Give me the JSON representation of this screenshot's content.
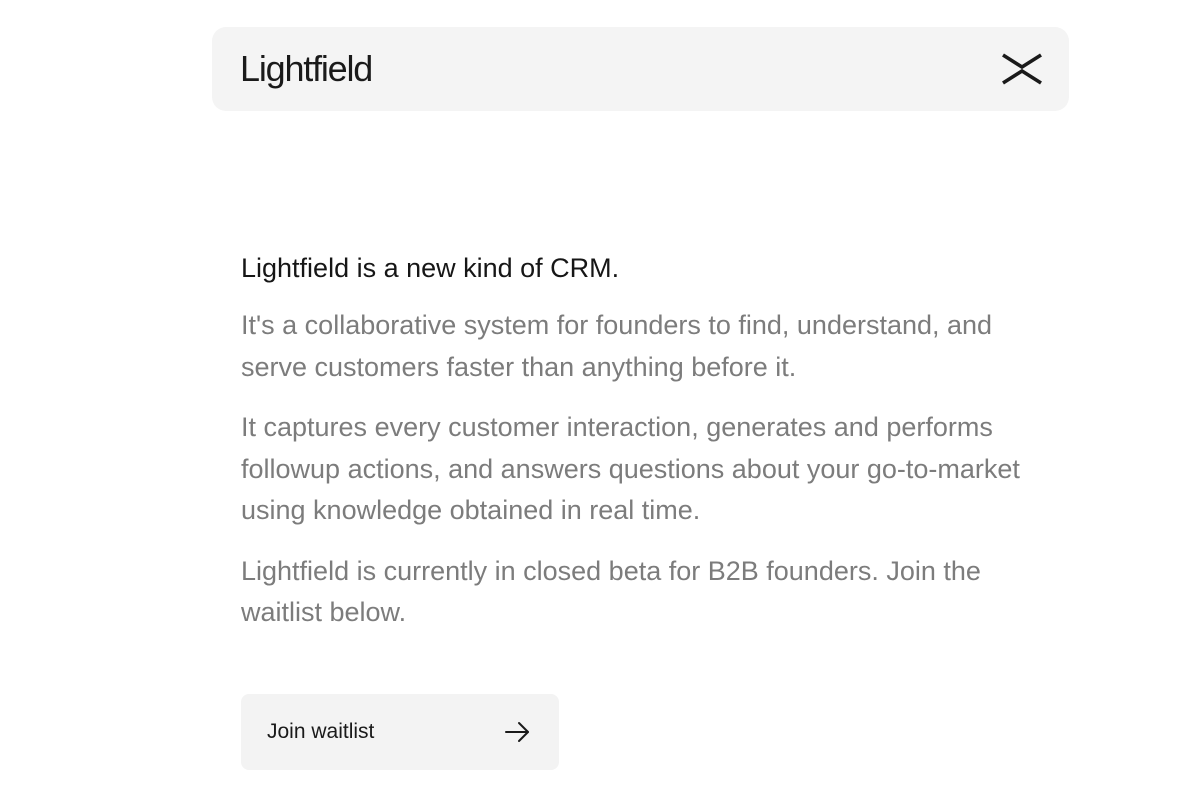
{
  "header": {
    "brand": "Lightfield",
    "logo_icon": "lightfield-x-logo-icon"
  },
  "intro": {
    "lead": "Lightfield is a new kind of CRM.",
    "paragraphs": [
      "It's a collaborative system for founders to find, understand, and serve customers faster than anything before it.",
      "It captures every customer interaction, generates and performs followup actions, and answers questions about your go-to-market using knowledge obtained in real time.",
      "Lightfield is currently in closed beta for B2B founders. Join the waitlist below."
    ]
  },
  "cta": {
    "label": "Join waitlist",
    "icon": "arrow-right-icon"
  }
}
